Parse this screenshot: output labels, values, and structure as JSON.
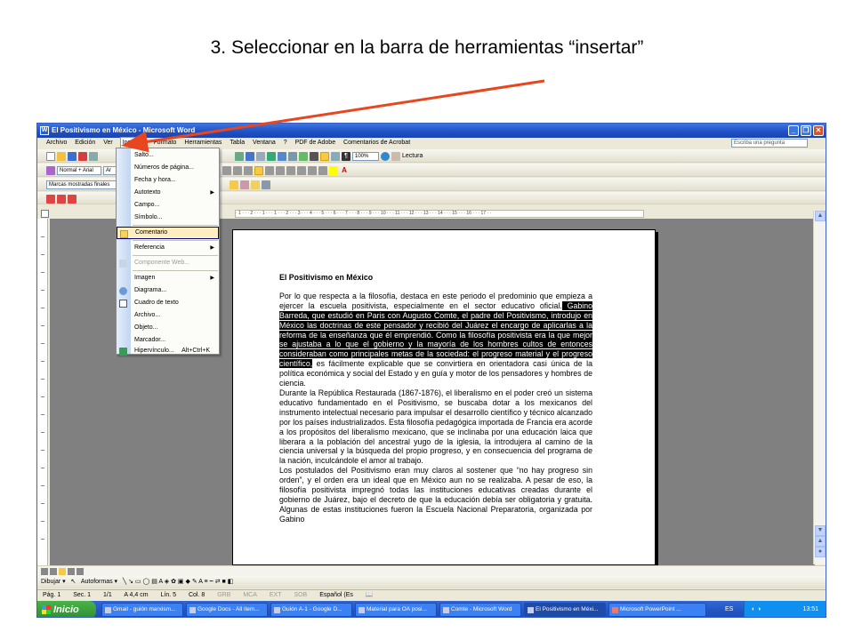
{
  "slide": {
    "instruction": "3. Seleccionar en la barra de herramientas “insertar”"
  },
  "window": {
    "title": "El Positivismo en México - Microsoft Word"
  },
  "menubar": {
    "items": [
      "Archivo",
      "Edición",
      "Ver",
      "Insertar",
      "Formato",
      "Herramientas",
      "Tabla",
      "Ventana",
      "?",
      "PDF de Adobe",
      "Comentarios de Acrobat"
    ],
    "help_placeholder": "Escriba una pregunta"
  },
  "toolbars": {
    "zoom": "100%",
    "reading": "Lectura",
    "style": "Normal + Arial",
    "font": "Ar",
    "markup": "Marcas mostradas finales"
  },
  "insert_menu": {
    "items": [
      {
        "label": "Salto...",
        "submenu": false,
        "disabled": false,
        "highlighted": false,
        "shortcut": ""
      },
      {
        "label": "Números de página...",
        "submenu": false,
        "disabled": false,
        "highlighted": false,
        "shortcut": ""
      },
      {
        "label": "Fecha y hora...",
        "submenu": false,
        "disabled": false,
        "highlighted": false,
        "shortcut": ""
      },
      {
        "label": "Autotexto",
        "submenu": true,
        "disabled": false,
        "highlighted": false,
        "shortcut": ""
      },
      {
        "label": "Campo...",
        "submenu": false,
        "disabled": false,
        "highlighted": false,
        "shortcut": ""
      },
      {
        "label": "Símbolo...",
        "submenu": false,
        "disabled": false,
        "highlighted": false,
        "shortcut": ""
      },
      {
        "label": "Comentario",
        "submenu": false,
        "disabled": false,
        "highlighted": true,
        "shortcut": ""
      },
      {
        "label": "Referencia",
        "submenu": true,
        "disabled": false,
        "highlighted": false,
        "shortcut": ""
      },
      {
        "label": "Componente Web...",
        "submenu": false,
        "disabled": true,
        "highlighted": false,
        "shortcut": ""
      },
      {
        "label": "Imagen",
        "submenu": true,
        "disabled": false,
        "highlighted": false,
        "shortcut": ""
      },
      {
        "label": "Diagrama...",
        "submenu": false,
        "disabled": false,
        "highlighted": false,
        "shortcut": ""
      },
      {
        "label": "Cuadro de texto",
        "submenu": false,
        "disabled": false,
        "highlighted": false,
        "shortcut": ""
      },
      {
        "label": "Archivo...",
        "submenu": false,
        "disabled": false,
        "highlighted": false,
        "shortcut": ""
      },
      {
        "label": "Objeto...",
        "submenu": false,
        "disabled": false,
        "highlighted": false,
        "shortcut": ""
      },
      {
        "label": "Marcador...",
        "submenu": false,
        "disabled": false,
        "highlighted": false,
        "shortcut": ""
      },
      {
        "label": "Hipervínculo...",
        "submenu": false,
        "disabled": false,
        "highlighted": false,
        "shortcut": "Alt+Ctrl+K"
      }
    ]
  },
  "ruler": {
    "scale": "· 1 · · · 2 · · · 1 · · · 1 · · · 2 · · · 3 · · · 4 · · · 5 · · · 6 · · · 7 · · · 8 · · · 9 · · · 10 · · · 11 · · · 12 · · · 13 · · · 14 · · · 15 · · · 16 · · · 17 · ·"
  },
  "document": {
    "heading": "El Positivismo en México",
    "p1_before": "Por lo que respecta  a la filosofía, destaca en este periodo el predominio que empieza a ejercer la escuela positivista, especialmente en el sector educativo oficial.",
    "p1_selected": "  Gabino Barreda, que estudió en Paris con  Augusto Comte, el padre del Positivismo, introdujo en México las doctrinas de este pensador  y recibió del Juárez el encargo  de aplicarlas a la reforma de la enseñanza que él emprendió.  Como la filosofía positivista era la que mejor se ajustaba a lo que el gobierno y la mayoría de los hombres cultos de entonces consideraban como principales metas de la sociedad: el progreso material y el progreso científico,",
    "p1_after": " es fácilmente explicable que se convirtiera en orientadora casi única de la política económica y social del Estado y en guía y motor de los pensadores y hombres  de ciencia.",
    "p2": "Durante la República Restaurada (1867-1876), el liberalismo en el poder  creó un sistema educativo fundamentado en el Positivismo, se buscaba dotar a los mexicanos del instrumento intelectual necesario para impulsar el desarrollo científico y técnico alcanzado por los países industrializados. Esta filosofía pedagógica importada de Francia  era acorde a los propósitos del liberalismo mexicano, que se inclinaba por una educación laica que liberara a la población del ancestral yugo de la iglesia, la introdujera al camino de la ciencia universal y la búsqueda del propio progreso, y en consecuencia del programa de la nación, inculcándole el amor al trabajo.",
    "p3": " Los postulados del Positivismo eran muy claros al sostener que “no hay progreso sin orden”, y el orden era un ideal que en México aun no se realizaba.  A pesar de eso, la filosofía positivista impregnó todas las instituciones educativas creadas durante el gobierno de Juárez, bajo el decreto de que la educación debía ser obligatoria y gratuita.  Algunas de estas instituciones fueron la Escuela Nacional Preparatoria, organizada por Gabino"
  },
  "drawbar": {
    "draw": "Dibujar",
    "autoshapes": "Autoformas"
  },
  "status": {
    "page": "Pág. 1",
    "section": "Sec. 1",
    "pages": "1/1",
    "at": "A 4,4 cm",
    "line": "Lín. 5",
    "col": "Col. 8",
    "grb": "GRB",
    "mca": "MCA",
    "ext": "EXT",
    "sob": "SOB",
    "lang": "Español (Es"
  },
  "taskbar": {
    "start": "Inicio",
    "tasks": [
      "Gmail - guión marxism...",
      "Google Docs - All item...",
      "Guión A-1 - Google D...",
      "Material para OA posi...",
      "Comte - Microsoft Word",
      "El Positivismo en Méxi...",
      "Microsoft PowerPoint ..."
    ],
    "lang": "ES",
    "time": "13:51"
  },
  "colors": {
    "accent": "#1f4fc5",
    "arrow": "#e8461e",
    "menu_highlight": "#ffeec2"
  }
}
